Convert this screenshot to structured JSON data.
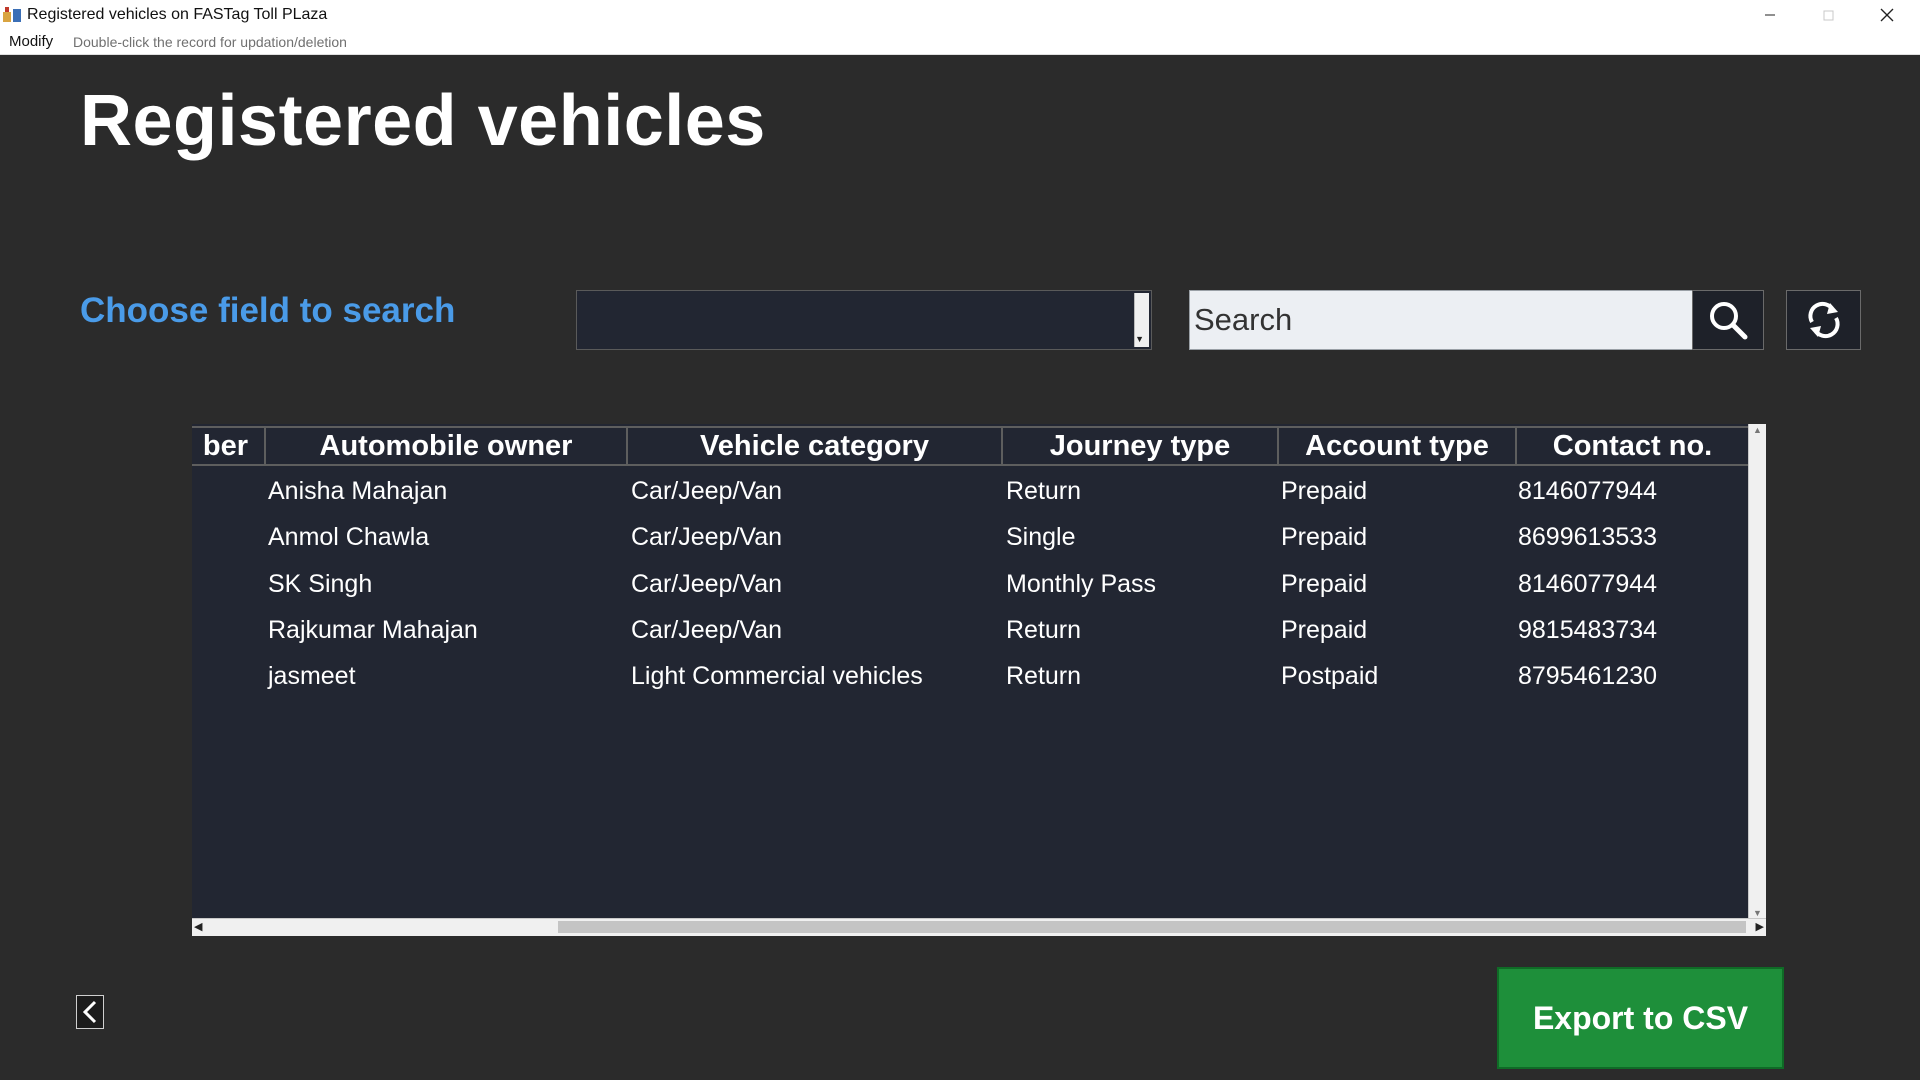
{
  "window": {
    "title": "Registered vehicles on FASTag Toll PLaza",
    "icon": "app-vehicle-icon"
  },
  "menubar": {
    "items": [
      "Modify"
    ],
    "hint": "Double-click the record for updation/deletion"
  },
  "page": {
    "title": "Registered vehicles",
    "search_label": "Choose field to search",
    "field_select_value": "",
    "search_placeholder": "Search",
    "export_label": "Export to CSV"
  },
  "colors": {
    "background": "#2b2b2b",
    "table_bg": "#222632",
    "label_blue": "#4a9be8",
    "export_green": "#1e8f3a"
  },
  "table": {
    "columns": [
      "ber",
      "Automobile owner",
      "Vehicle category",
      "Journey type",
      "Account type",
      "Contact no."
    ],
    "rows": [
      [
        "",
        "Anisha Mahajan",
        "Car/Jeep/Van",
        "Return",
        "Prepaid",
        "8146077944"
      ],
      [
        "",
        "Anmol Chawla",
        "Car/Jeep/Van",
        "Single",
        "Prepaid",
        "8699613533"
      ],
      [
        "",
        "SK Singh",
        "Car/Jeep/Van",
        "Monthly Pass",
        "Prepaid",
        "8146077944"
      ],
      [
        "",
        "Rajkumar Mahajan",
        "Car/Jeep/Van",
        "Return",
        "Prepaid",
        "9815483734"
      ],
      [
        "",
        "jasmeet",
        "Light Commercial vehicles",
        "Return",
        "Postpaid",
        "8795461230"
      ]
    ]
  }
}
